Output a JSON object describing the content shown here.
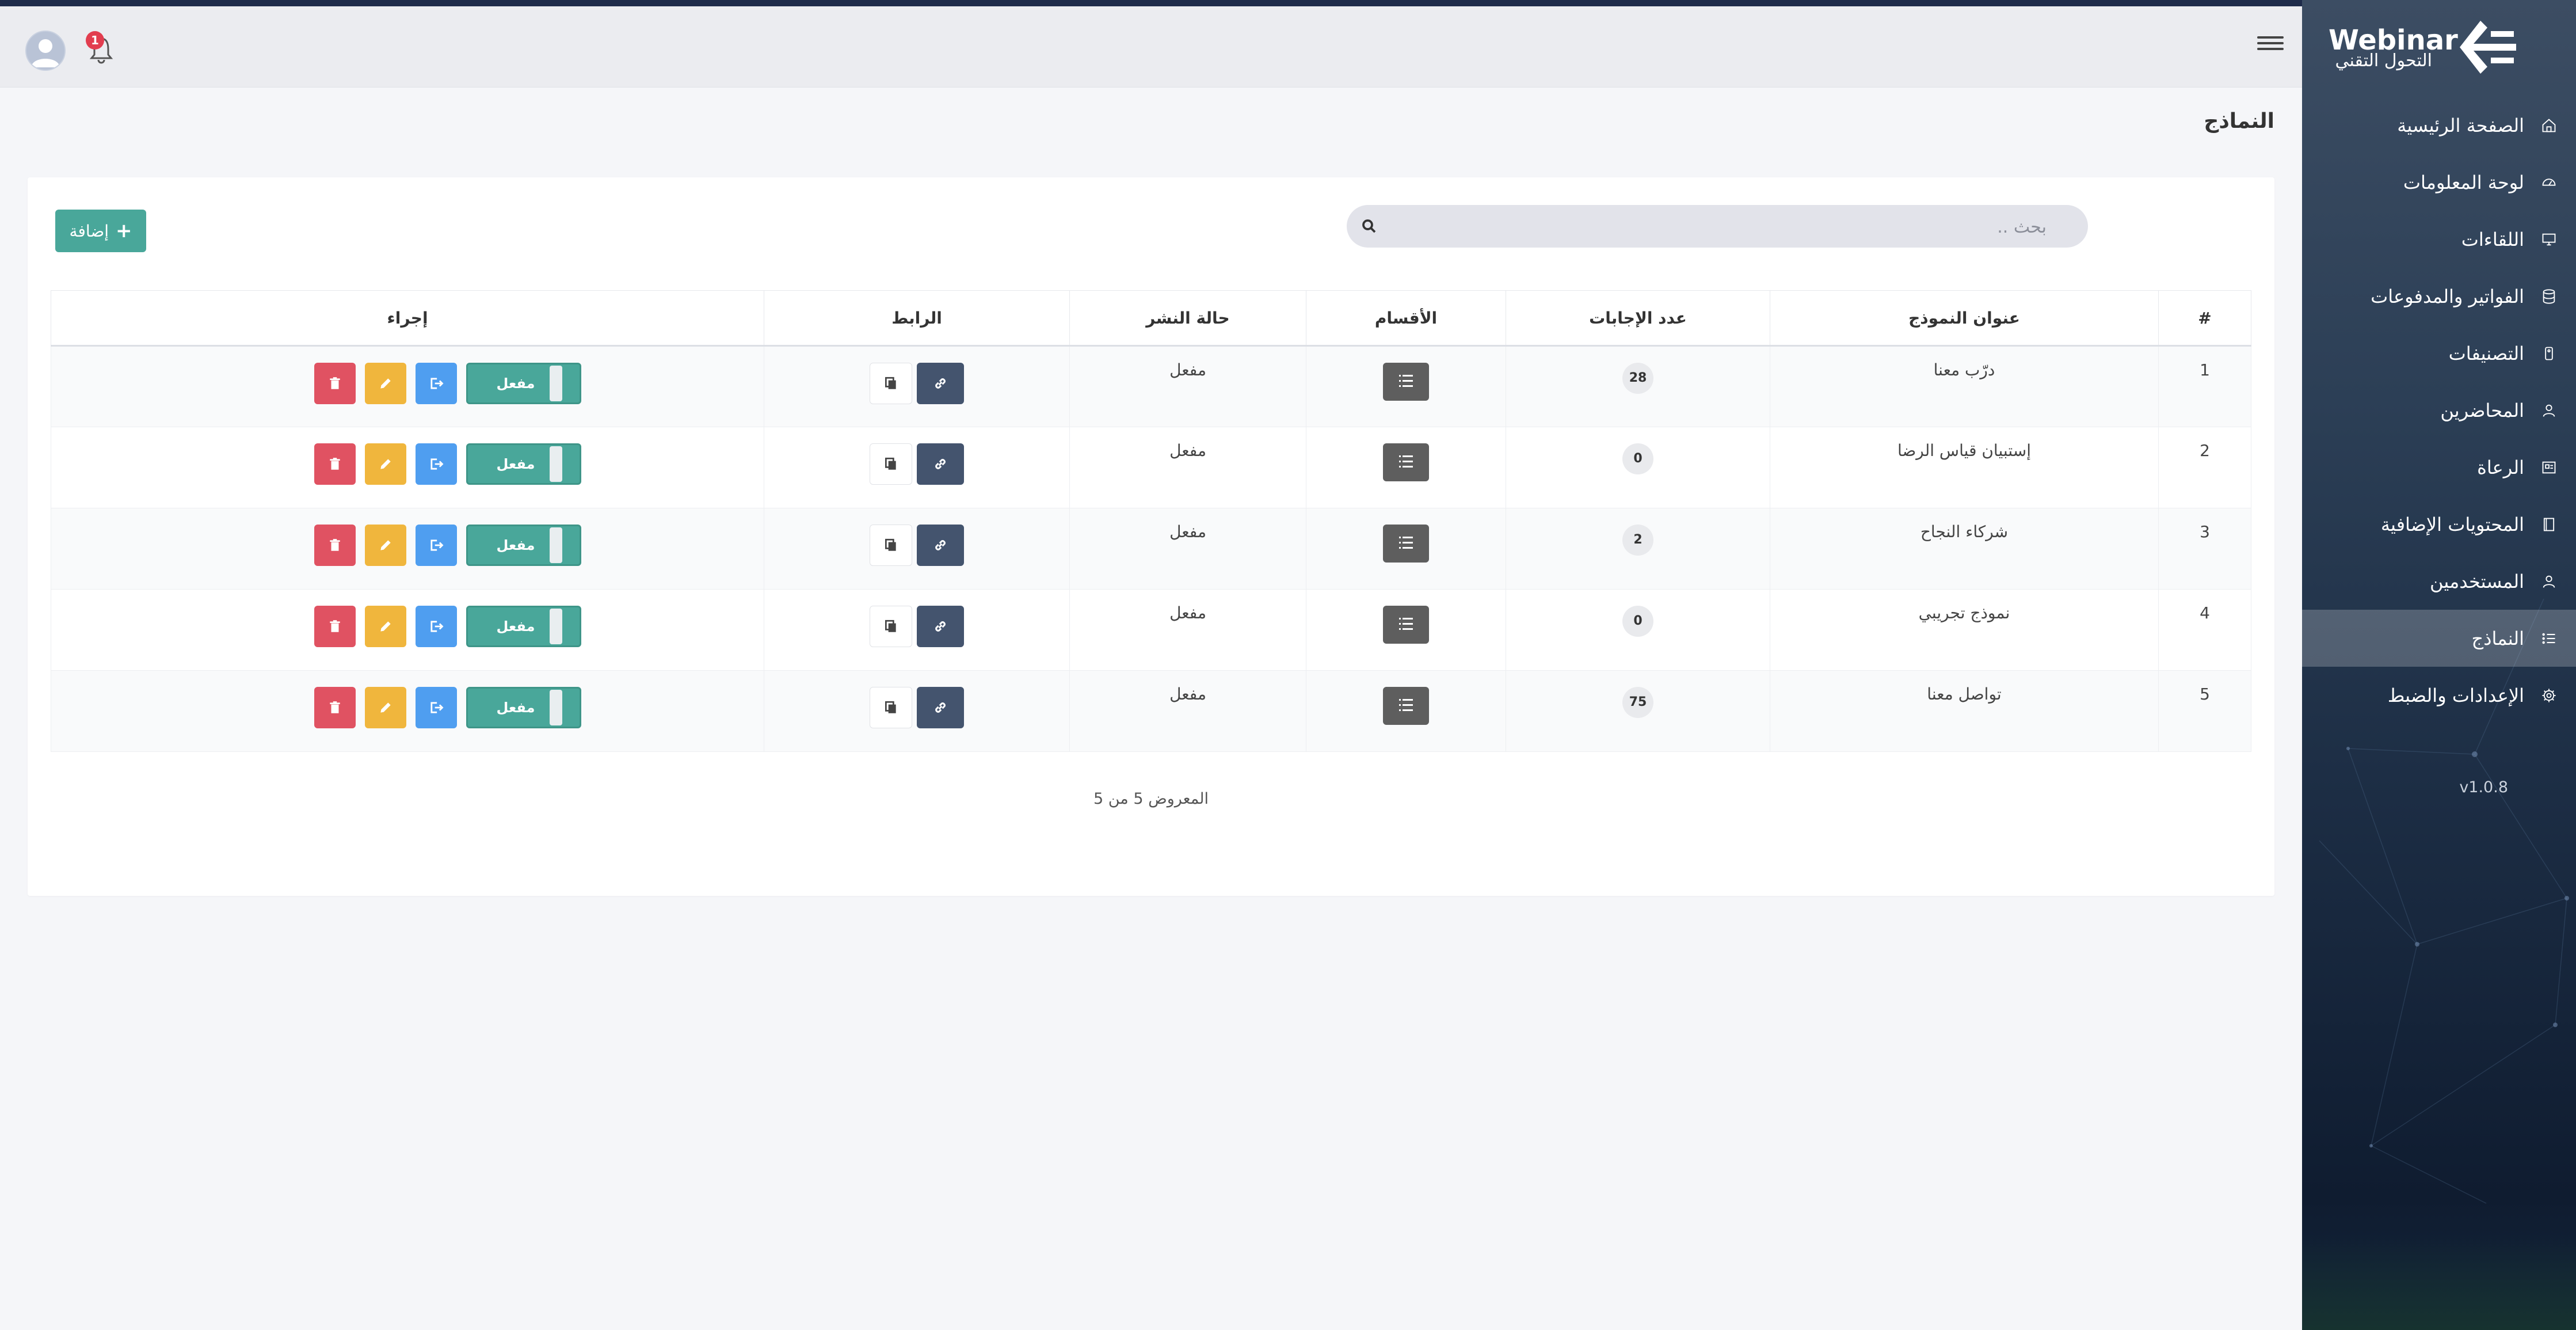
{
  "app": {
    "logo_text": "Webinar",
    "logo_sub": "التحول التقني",
    "version": "v1.0.8",
    "notification_count": "1"
  },
  "sidebar": {
    "items": [
      {
        "label": "الصفحة الرئيسية",
        "icon": "home-icon"
      },
      {
        "label": "لوحة المعلومات",
        "icon": "dashboard-icon"
      },
      {
        "label": "اللقاءات",
        "icon": "monitor-icon"
      },
      {
        "label": "الفواتير والمدفوعات",
        "icon": "database-icon"
      },
      {
        "label": "التصنيفات",
        "icon": "tag-icon"
      },
      {
        "label": "المحاضرين",
        "icon": "user-icon"
      },
      {
        "label": "الرعاة",
        "icon": "sponsor-icon"
      },
      {
        "label": "المحتويات الإضافية",
        "icon": "book-icon"
      },
      {
        "label": "المستخدمين",
        "icon": "users-icon"
      },
      {
        "label": "النماذج",
        "icon": "list-icon",
        "active": true
      },
      {
        "label": "الإعدادات والضبط",
        "icon": "gear-icon"
      }
    ]
  },
  "page": {
    "title": "النماذج"
  },
  "search": {
    "placeholder": "بحث .."
  },
  "toolbar": {
    "add_label": "إضافة"
  },
  "table": {
    "headers": {
      "num": "#",
      "title": "عنوان النموذج",
      "answers": "عدد الإجابات",
      "sections": "الأقسام",
      "publish": "حالة النشر",
      "link": "الرابط",
      "action": "إجراء"
    },
    "rows": [
      {
        "num": "1",
        "title": "درّب معنا",
        "answers": "28",
        "publish": "مفعل",
        "toggle": "مفعل"
      },
      {
        "num": "2",
        "title": "إستبيان قياس الرضا",
        "answers": "0",
        "publish": "مفعل",
        "toggle": "مفعل"
      },
      {
        "num": "3",
        "title": "شركاء النجاح",
        "answers": "2",
        "publish": "مفعل",
        "toggle": "مفعل"
      },
      {
        "num": "4",
        "title": "نموذج تجريبي",
        "answers": "0",
        "publish": "مفعل",
        "toggle": "مفعل"
      },
      {
        "num": "5",
        "title": "تواصل معنا",
        "answers": "75",
        "publish": "مفعل",
        "toggle": "مفعل"
      }
    ]
  },
  "footer": {
    "count_text": "المعروض 5 من 5"
  },
  "colors": {
    "accent": "#49a79a",
    "danger": "#e05262",
    "warning": "#f0b63d",
    "info": "#4f9ef0",
    "link_btn": "#44546e",
    "sidebar": "#2c3f56"
  }
}
